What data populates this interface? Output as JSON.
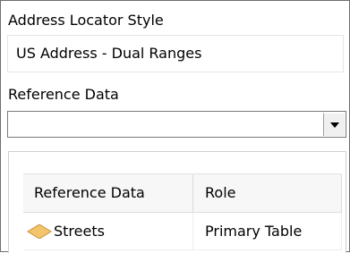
{
  "address_locator_style": {
    "label": "Address Locator Style",
    "value": "US Address - Dual Ranges"
  },
  "reference_data": {
    "label": "Reference Data",
    "selected": ""
  },
  "table": {
    "columns": [
      "Reference Data",
      "Role"
    ],
    "rows": [
      {
        "icon": "diamond-icon",
        "name": "Streets",
        "role": "Primary Table"
      }
    ]
  },
  "colors": {
    "diamond_fill": "#f4c46a",
    "diamond_stroke": "#c8923a"
  }
}
